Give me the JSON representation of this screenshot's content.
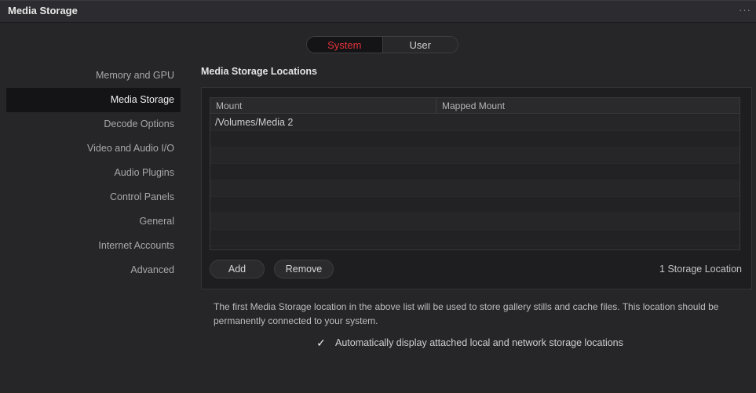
{
  "window": {
    "title": "Media Storage",
    "menu_icon": "more-horizontal-icon"
  },
  "tabs": {
    "system": "System",
    "user": "User",
    "selected": "System"
  },
  "sidebar": {
    "items": [
      {
        "label": "Memory and GPU"
      },
      {
        "label": "Media Storage"
      },
      {
        "label": "Decode Options"
      },
      {
        "label": "Video and Audio I/O"
      },
      {
        "label": "Audio Plugins"
      },
      {
        "label": "Control Panels"
      },
      {
        "label": "General"
      },
      {
        "label": "Internet Accounts"
      },
      {
        "label": "Advanced"
      }
    ],
    "active": "Media Storage"
  },
  "main": {
    "section_title": "Media Storage Locations",
    "table": {
      "columns": [
        "Mount",
        "Mapped Mount"
      ],
      "rows": [
        {
          "mount": "/Volumes/Media 2",
          "mapped": ""
        }
      ]
    },
    "buttons": {
      "add": "Add",
      "remove": "Remove"
    },
    "count_label": "1 Storage Location",
    "note": "The first Media Storage location in the above list will be used to store gallery stills and cache files. This location should be permanently connected to your system.",
    "auto_display": {
      "label": "Automatically display attached local and network storage locations",
      "checked": true
    }
  }
}
